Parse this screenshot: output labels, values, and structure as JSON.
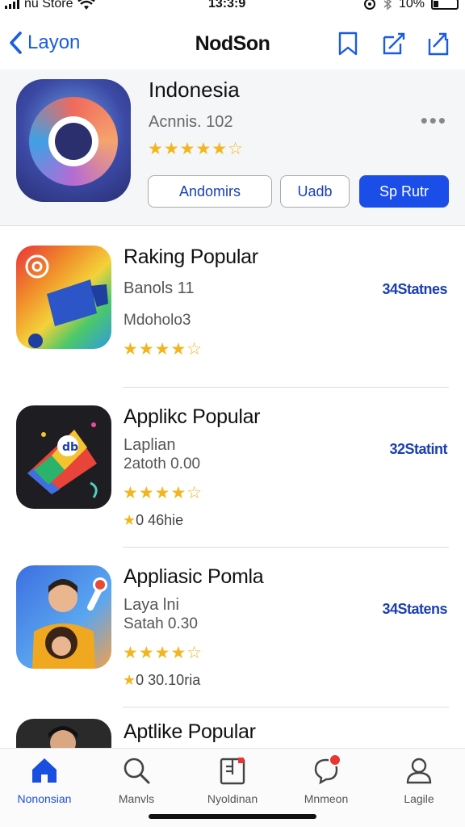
{
  "status_bar": {
    "carrier": "nu Store",
    "time": "13:3:9",
    "battery": "10%"
  },
  "nav": {
    "back_label": "Layon",
    "title": "NodSon"
  },
  "header": {
    "title": "Indonesia",
    "subtitle": "Acnnis. 102",
    "stars": "★★★★★☆",
    "btn_outline_1": "Andomirs",
    "btn_outline_2": "Uadb",
    "btn_primary": "Sp Rutr",
    "more": "•••"
  },
  "list": [
    {
      "title": "Raking Popular",
      "sub1": "Banols 11",
      "sub2": "Mdoholo3",
      "stars": "★★★★☆",
      "right": "34Statnes",
      "extra": ""
    },
    {
      "title": "Applikc Popular",
      "sub1": "Laplian",
      "sub2": "2atoth 0.00",
      "stars": "★★★★☆",
      "right": "32Statint",
      "extra_star": "★",
      "extra": "0 46hie"
    },
    {
      "title": "Appliasic Pomla",
      "sub1": "Laya lni",
      "sub2": "Satah 0.30",
      "stars": "★★★★☆",
      "right": "34Statens",
      "extra_star": "★",
      "extra": "0 30.10ria"
    },
    {
      "title": "Aptlike Popular"
    }
  ],
  "tabs": [
    {
      "label": "Nononsian",
      "icon": "home-icon",
      "active": true
    },
    {
      "label": "Manvls",
      "icon": "search-icon"
    },
    {
      "label": "Nyoldinan",
      "icon": "document-icon"
    },
    {
      "label": "Mnmeon",
      "icon": "chat-icon"
    },
    {
      "label": "Lagile",
      "icon": "person-icon"
    }
  ],
  "colors": {
    "accent": "#1b4ee8",
    "star": "#f2b51c",
    "badge": "#e33333"
  }
}
